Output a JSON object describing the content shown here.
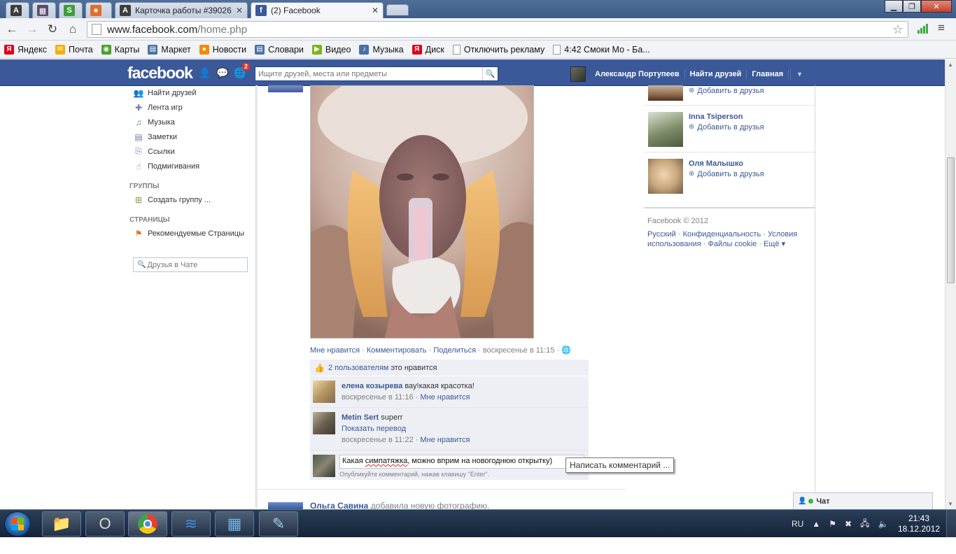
{
  "browser": {
    "tabs": [
      {
        "label": "",
        "favicon": "A",
        "color": "#3d3d3d"
      },
      {
        "label": "",
        "favicon": "",
        "color": "#5a4a6e"
      },
      {
        "label": "",
        "favicon": "S",
        "color": "#3f9d3b"
      },
      {
        "label": "",
        "favicon": "",
        "color": "#e36b2c"
      },
      {
        "label": "Карточка работы #39026",
        "favicon": "A",
        "color": "#3d3d3d"
      },
      {
        "label": "(2) Facebook",
        "favicon": "f",
        "color": "#3b5998"
      }
    ],
    "url_host": "www.facebook.com",
    "url_path": "/home.php",
    "bookmarks": [
      {
        "label": "Яндекс",
        "icon": "yandex-icon",
        "color": "#e0001b",
        "glyph": "Я"
      },
      {
        "label": "Почта",
        "icon": "mail-icon",
        "color": "#f3b000",
        "glyph": "✉"
      },
      {
        "label": "Карты",
        "icon": "maps-icon",
        "color": "#4aa02c",
        "glyph": "◉"
      },
      {
        "label": "Маркет",
        "icon": "market-icon",
        "color": "#4a6fa5",
        "glyph": "▤"
      },
      {
        "label": "Новости",
        "icon": "news-icon",
        "color": "#f08c00",
        "glyph": "●"
      },
      {
        "label": "Словари",
        "icon": "dictionary-icon",
        "color": "#4a6fa5",
        "glyph": "▤"
      },
      {
        "label": "Видео",
        "icon": "video-icon",
        "color": "#7ab51d",
        "glyph": "▶"
      },
      {
        "label": "Музыка",
        "icon": "music-icon",
        "color": "#4a6fa5",
        "glyph": "♪"
      },
      {
        "label": "Диск",
        "icon": "disk-icon",
        "color": "#e0001b",
        "glyph": "Я"
      },
      {
        "label": "Отключить рекламу",
        "icon": "page-icon",
        "color": "#ffffff",
        "glyph": ""
      },
      {
        "label": "4:42 Смоки Мо - Ба...",
        "icon": "page-icon",
        "color": "#ffffff",
        "glyph": ""
      }
    ]
  },
  "fb": {
    "logo": "facebook",
    "notif_count": "2",
    "search_placeholder": "Ищите друзей, места или предметы",
    "user_name": "Александр Портупеев",
    "find_friends": "Найти друзей",
    "home": "Главная"
  },
  "leftnav": {
    "items": [
      {
        "label": "Найти друзей",
        "icon": "find-friends-icon",
        "glyph": "👥"
      },
      {
        "label": "Лента игр",
        "icon": "games-icon",
        "glyph": "✚"
      },
      {
        "label": "Музыка",
        "icon": "music-icon",
        "glyph": "♫"
      },
      {
        "label": "Заметки",
        "icon": "notes-icon",
        "glyph": "▤"
      },
      {
        "label": "Ссылки",
        "icon": "links-icon",
        "glyph": "⎘"
      },
      {
        "label": "Подмигивания",
        "icon": "poke-icon",
        "glyph": "☝"
      }
    ],
    "groups_heading": "ГРУППЫ",
    "create_group": "Создать группу ...",
    "pages_heading": "СТРАНИЦЫ",
    "recommended_pages": "Рекомендуемые Страницы",
    "chat_search_placeholder": "Друзья в Чате"
  },
  "story": {
    "actions": {
      "like": "Мне нравится",
      "comment": "Комментировать",
      "share": "Поделиться",
      "time": "воскресенье в 11:15"
    },
    "likes_link": "2 пользователям",
    "likes_text": "это нравится",
    "comments": [
      {
        "name": "елена козырева",
        "text": "вау!какая красотка!",
        "time": "воскресенье в 11:16",
        "like": "Мне нравится",
        "avatar_color": "#c8b68a"
      },
      {
        "name": "Metin Sert",
        "text": "superr",
        "translate": "Показать перевод",
        "time": "воскресенье в 11:22",
        "like": "Мне нравится",
        "avatar_color": "#6b6150"
      }
    ],
    "compose_text_before": "Какая ",
    "compose_text_misspelled": "симпатяжка",
    "compose_text_after": ", можно вприм на новогоднюю открытку)",
    "compose_hint": "Опубликуйте комментарий, нажав клавишу \"Enter\".",
    "tooltip": "Написать комментарий ...",
    "next_author": "Ольга Савина",
    "next_text": "добавила новую фотографию."
  },
  "right": {
    "suggestions": [
      {
        "name": "",
        "add": "Добавить в друзья",
        "avatar_color": "#8f6a4d"
      },
      {
        "name": "Inna Tsiperson",
        "add": "Добавить в друзья",
        "avatar_color": "#7d8a68"
      },
      {
        "name": "Оля Малышко",
        "add": "Добавить в друзья",
        "avatar_color": "#c9a77c"
      }
    ],
    "footer_copyright": "Facebook © 2012",
    "footer_links": [
      "Русский",
      "Конфиденциальность",
      "Условия использования",
      "Файлы cookie",
      "Ещё ▾"
    ]
  },
  "chat": {
    "label": "Чат"
  },
  "taskbar": {
    "apps": [
      {
        "name": "explorer-app-icon",
        "glyph": "📁",
        "color": "#f3c443"
      },
      {
        "name": "opera-app-icon",
        "glyph": "O",
        "color": "#d8d8d8"
      },
      {
        "name": "chrome-app-icon",
        "glyph": "",
        "color": "#e34133"
      },
      {
        "name": "winamp-app-icon",
        "glyph": "≋",
        "color": "#3a8fe0"
      },
      {
        "name": "control-panel-app-icon",
        "glyph": "▦",
        "color": "#6fb5e8"
      },
      {
        "name": "editor-app-icon",
        "glyph": "✎",
        "color": "#9bd1f5"
      }
    ],
    "language": "RU",
    "time": "21:43",
    "date": "18.12.2012"
  },
  "colors": {
    "fb_blue": "#3b5998",
    "link": "#3b5998",
    "meta_gray": "#808080"
  }
}
